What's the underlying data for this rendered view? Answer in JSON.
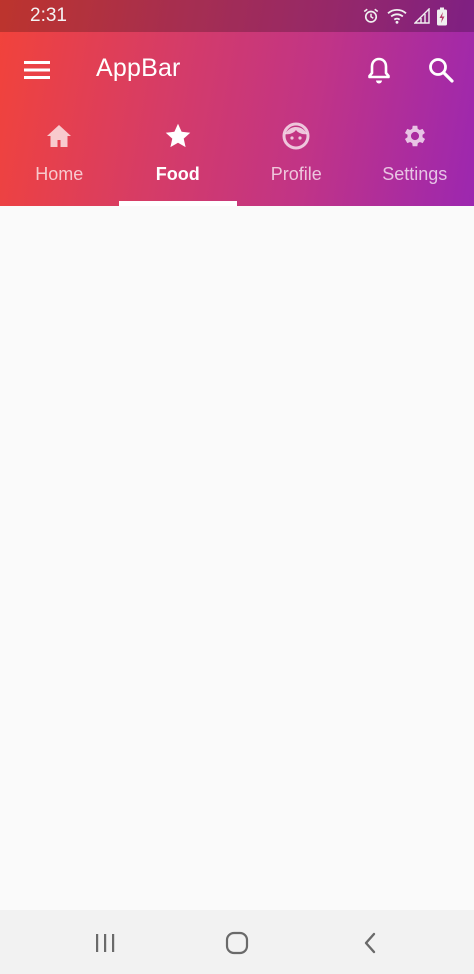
{
  "status_bar": {
    "time": "2:31",
    "icons": [
      "alarm-icon",
      "wifi-icon",
      "signal-icon",
      "battery-charging-icon"
    ]
  },
  "app_bar": {
    "title": "AppBar",
    "menu_icon": "menu-icon",
    "actions": [
      "bell-icon",
      "search-icon"
    ]
  },
  "tabs": [
    {
      "label": "Home",
      "icon": "home-icon",
      "active": false
    },
    {
      "label": "Food",
      "icon": "star-icon",
      "active": true
    },
    {
      "label": "Profile",
      "icon": "face-icon",
      "active": false
    },
    {
      "label": "Settings",
      "icon": "gear-icon",
      "active": false
    }
  ],
  "nav_bar": {
    "buttons": [
      "recent-apps-icon",
      "home-circle-icon",
      "back-icon"
    ]
  },
  "colors": {
    "gradient_start": "#f2433a",
    "gradient_end": "#9c27b0",
    "indicator": "#ffffff",
    "background": "#fafafa"
  }
}
